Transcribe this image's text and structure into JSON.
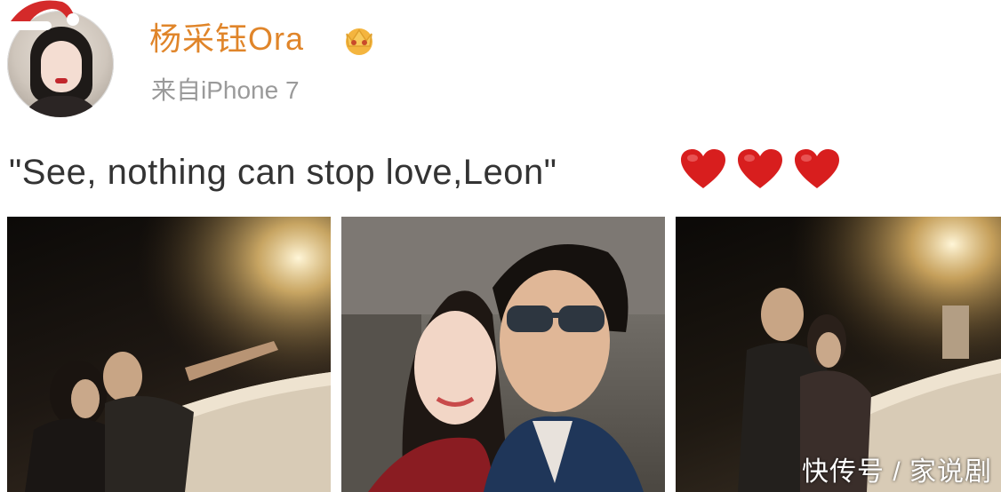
{
  "post": {
    "username": "杨采钰Ora",
    "source": "来自iPhone 7",
    "text": "\"See, nothing can stop love,Leon\"",
    "heart_count": 3,
    "badge_icon": "vip-crown-badge-icon"
  },
  "photos": [
    {
      "name": "photo-night-selfie-1"
    },
    {
      "name": "photo-couple-selfie"
    },
    {
      "name": "photo-night-selfie-2"
    }
  ],
  "watermark": "快传号 / 家说剧",
  "colors": {
    "username": "#e0852a",
    "source": "#9a9a9a",
    "text": "#333333",
    "heart": "#d81e1e"
  }
}
